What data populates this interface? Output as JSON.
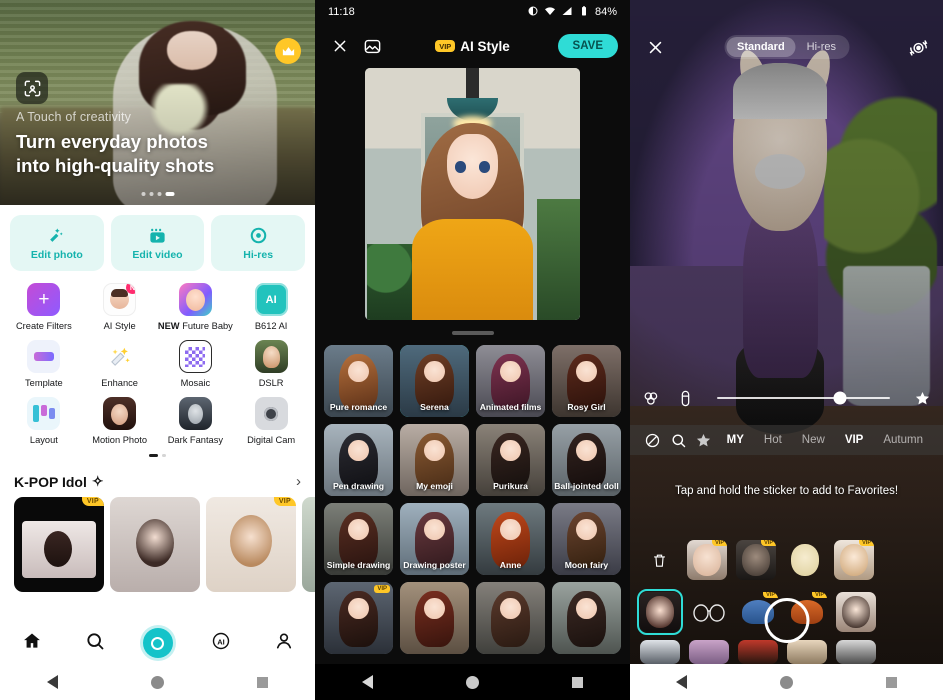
{
  "panel1": {
    "hero": {
      "kicker": "A Touch of creativity",
      "title_line1": "Turn everyday photos",
      "title_line2": "into high-quality shots",
      "crown_icon": "crown-icon",
      "scan_icon": "face-scan-icon"
    },
    "quick_actions": [
      {
        "label": "Edit photo",
        "icon": "magic-wand-icon"
      },
      {
        "label": "Edit video",
        "icon": "video-clip-icon"
      },
      {
        "label": "Hi-res",
        "icon": "camera-ring-icon"
      }
    ],
    "tools": [
      {
        "label": "Create Filters",
        "icon": "plus-square-icon",
        "badge": ""
      },
      {
        "label": "AI Style",
        "icon": "ai-style-icon",
        "badge": "N"
      },
      {
        "label": "Future Baby",
        "prefix": "NEW",
        "icon": "future-baby-icon",
        "badge": ""
      },
      {
        "label": "B612 AI",
        "icon": "ai-chip-icon",
        "badge": ""
      },
      {
        "label": "Template",
        "icon": "template-icon",
        "badge": ""
      },
      {
        "label": "Enhance",
        "icon": "sparkle-wand-icon",
        "badge": ""
      },
      {
        "label": "Mosaic",
        "icon": "mosaic-icon",
        "badge": ""
      },
      {
        "label": "DSLR",
        "icon": "dslr-icon",
        "badge": ""
      },
      {
        "label": "Layout",
        "icon": "layout-icon",
        "badge": ""
      },
      {
        "label": "Motion Photo",
        "icon": "motion-photo-icon",
        "badge": ""
      },
      {
        "label": "Dark Fantasy",
        "icon": "dark-fantasy-icon",
        "badge": ""
      },
      {
        "label": "Digital Cam",
        "icon": "digital-cam-icon",
        "badge": ""
      }
    ],
    "kpop": {
      "title": "K-POP Idol",
      "sparkle": "✧",
      "chevron": "›",
      "cards": [
        {
          "vip": "VIP"
        },
        {
          "vip": ""
        },
        {
          "vip": "VIP"
        },
        {
          "vip": ""
        }
      ]
    },
    "tabbar": [
      {
        "name": "home-tab",
        "icon": "home-icon"
      },
      {
        "name": "search-tab",
        "icon": "search-icon"
      },
      {
        "name": "camera-tab",
        "icon": "shutter-icon"
      },
      {
        "name": "ai-tab",
        "icon": "ai-circle-icon"
      },
      {
        "name": "profile-tab",
        "icon": "person-icon"
      }
    ]
  },
  "panel2": {
    "status": {
      "time": "11:18",
      "battery": "84%"
    },
    "header": {
      "close_icon": "close-icon",
      "gallery_icon": "photo-icon",
      "vip_badge": "VIP",
      "title": "AI Style",
      "save_label": "SAVE"
    },
    "preview": {
      "compare_icon": "compare-icon"
    },
    "styles": [
      {
        "label": "Pure romance",
        "selected": false,
        "vip": "",
        "bg1": "#6b7c8a",
        "bg2": "#3c4750",
        "hair": "#b5703c"
      },
      {
        "label": "Serena",
        "selected": true,
        "vip": "",
        "bg1": "#4f6a7c",
        "bg2": "#2b3a46",
        "hair": "#6f3f26"
      },
      {
        "label": "Animated films",
        "selected": false,
        "vip": "",
        "bg1": "#8e8d95",
        "bg2": "#4a4952",
        "hair": "#7e3350"
      },
      {
        "label": "Rosy Girl",
        "selected": false,
        "vip": "",
        "bg1": "#7e6f68",
        "bg2": "#3d352f",
        "hair": "#5d2a1c"
      },
      {
        "label": "Pen drawing",
        "selected": false,
        "vip": "",
        "bg1": "#a8b4bd",
        "bg2": "#6b757d",
        "hair": "#1d1d22"
      },
      {
        "label": "My emoji",
        "selected": false,
        "vip": "",
        "bg1": "#b9ada4",
        "bg2": "#6f665f",
        "hair": "#8a5a33"
      },
      {
        "label": "Purikura",
        "selected": false,
        "vip": "",
        "bg1": "#8a8278",
        "bg2": "#45403a",
        "hair": "#2a1d18"
      },
      {
        "label": "Ball-jointed doll",
        "selected": false,
        "vip": "",
        "bg1": "#97a0a6",
        "bg2": "#5a6267",
        "hair": "#241a18"
      },
      {
        "label": "Simple drawing",
        "selected": false,
        "vip": "",
        "bg1": "#7c7f78",
        "bg2": "#3a3c38",
        "hair": "#5a2f22"
      },
      {
        "label": "Drawing poster",
        "selected": false,
        "vip": "",
        "bg1": "#9fb0bd",
        "bg2": "#5f6d78",
        "hair": "#6a3a3f"
      },
      {
        "label": "Anne",
        "selected": false,
        "vip": "",
        "bg1": "#6e7a7f",
        "bg2": "#343b3f",
        "hair": "#b23a14"
      },
      {
        "label": "Moon fairy",
        "selected": false,
        "vip": "",
        "bg1": "#7a7b86",
        "bg2": "#3b3c46",
        "hair": "#6b4430"
      },
      {
        "label": "",
        "selected": false,
        "vip": "VIP",
        "bg1": "#5d6672",
        "bg2": "#2b3038",
        "hair": "#4a2a22"
      },
      {
        "label": "",
        "selected": false,
        "vip": "",
        "bg1": "#a3917c",
        "bg2": "#5c4f42",
        "hair": "#7a2f20"
      },
      {
        "label": "",
        "selected": false,
        "vip": "",
        "bg1": "#84807a",
        "bg2": "#40403c",
        "hair": "#5b3a2c"
      },
      {
        "label": "",
        "selected": false,
        "vip": "",
        "bg1": "#9aa39f",
        "bg2": "#4e5450",
        "hair": "#3d2a24"
      }
    ]
  },
  "panel3": {
    "topbar": {
      "close_icon": "close-icon",
      "modes": [
        {
          "label": "Standard",
          "active": true
        },
        {
          "label": "Hi-res",
          "active": false
        }
      ],
      "flip_icon": "camera-flip-icon"
    },
    "slider": {
      "left_icon": "beauty-blur-icon",
      "second_icon": "skin-tone-icon",
      "value_percent": 71,
      "favorite_icon": "star-filled-icon"
    },
    "filter_tabs": [
      {
        "label": "",
        "icon": "none-circle-icon",
        "active": false
      },
      {
        "label": "",
        "icon": "search-icon",
        "active": false
      },
      {
        "label": "",
        "icon": "star-icon",
        "active": false
      },
      {
        "label": "MY",
        "icon": "",
        "active": true
      },
      {
        "label": "Hot",
        "icon": "",
        "active": false
      },
      {
        "label": "New",
        "icon": "",
        "active": false
      },
      {
        "label": "VIP",
        "icon": "",
        "active": true
      },
      {
        "label": "Autumn",
        "icon": "",
        "active": false
      }
    ],
    "tip": "Tap and hold the sticker to add to Favorites!",
    "sticker_row1": [
      {
        "icon": "trash-icon",
        "vip": ""
      },
      {
        "vip": "VIP",
        "kind": "glasses-girl"
      },
      {
        "vip": "VIP",
        "kind": "dark-portrait"
      },
      {
        "vip": "",
        "kind": "pale-face"
      },
      {
        "vip": "VIP",
        "kind": "blonde-girl"
      }
    ],
    "sticker_row2": [
      {
        "vip": "",
        "kind": "cat-ears-girl",
        "selected": true
      },
      {
        "vip": "",
        "kind": "sunglasses"
      },
      {
        "vip": "VIP",
        "kind": "blue-beanie"
      },
      {
        "vip": "VIP",
        "kind": "orange-beanie"
      },
      {
        "vip": "",
        "kind": "portrait-girl"
      }
    ],
    "sticker_row3": [
      {
        "kind": "panda"
      },
      {
        "kind": "pink"
      },
      {
        "kind": "red"
      },
      {
        "kind": "beige"
      },
      {
        "kind": "grey"
      }
    ]
  },
  "colors": {
    "accent_teal": "#14c3c9",
    "save_teal": "#2fdcd6",
    "vip_gold": "#ffc727",
    "badge_pink": "#ff2d6f"
  }
}
